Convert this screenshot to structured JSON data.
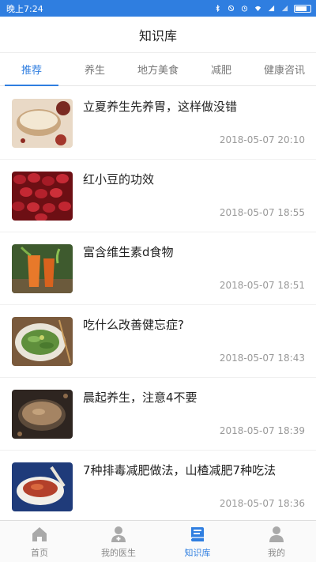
{
  "status_bar": {
    "time": "晚上7:24",
    "icons": [
      "bluetooth-icon",
      "mute-icon",
      "alarm-icon",
      "wifi-icon",
      "signal-icon",
      "signal-icon",
      "battery-icon"
    ]
  },
  "header": {
    "title": "知识库"
  },
  "tabs": [
    {
      "label": "推荐",
      "active": true
    },
    {
      "label": "养生",
      "active": false
    },
    {
      "label": "地方美食",
      "active": false
    },
    {
      "label": "减肥",
      "active": false
    },
    {
      "label": "健康咨讯",
      "active": false
    }
  ],
  "articles": [
    {
      "title": "立夏养生先养胃，这样做没错",
      "time": "2018-05-07 20:10",
      "image": "porridge-bowl-image"
    },
    {
      "title": "红小豆的功效",
      "time": "2018-05-07 18:55",
      "image": "red-beans-image"
    },
    {
      "title": "富含维生素d食物",
      "time": "2018-05-07 18:51",
      "image": "carrot-juice-image"
    },
    {
      "title": "吃什么改善健忘症?",
      "time": "2018-05-07 18:43",
      "image": "vegetable-plate-image"
    },
    {
      "title": "晨起养生，注意4不要",
      "time": "2018-05-07 18:39",
      "image": "grain-porridge-image"
    },
    {
      "title": "7种排毒减肥做法，山楂减肥7种吃法",
      "time": "2018-05-07 18:36",
      "image": "hawthorn-soup-image"
    }
  ],
  "bottom_nav": [
    {
      "label": "首页",
      "icon": "home-icon",
      "active": false
    },
    {
      "label": "我的医生",
      "icon": "doctor-icon",
      "active": false
    },
    {
      "label": "知识库",
      "icon": "book-icon",
      "active": true
    },
    {
      "label": "我的",
      "icon": "person-icon",
      "active": false
    }
  ],
  "colors": {
    "accent": "#2f7ee0",
    "status_bar": "#2f7ee0",
    "text_primary": "#222222",
    "text_secondary": "#999999"
  }
}
